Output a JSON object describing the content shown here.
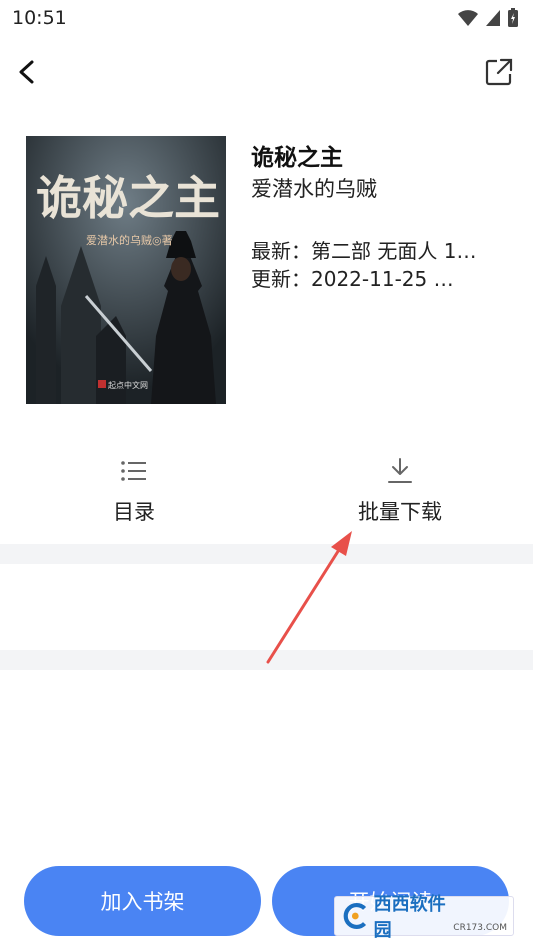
{
  "status_bar": {
    "time": "10:51"
  },
  "book": {
    "title": "诡秘之主",
    "author": "爱潜水的乌贼",
    "latest": "最新：第二部 无面人 1…",
    "updated": "更新：2022-11-25 …",
    "cover": {
      "title_art": "诡秘之主",
      "author_line": "爱潜水的乌贼◎著",
      "publisher": "起点中文网"
    }
  },
  "actions": [
    {
      "label": "目录",
      "icon": "list-icon"
    },
    {
      "label": "批量下载",
      "icon": "download-icon"
    }
  ],
  "bottom": {
    "add_shelf": "加入书架",
    "start_reading": "开始阅读"
  },
  "watermark": {
    "text": "西西软件园",
    "sub": "CR173.COM"
  },
  "colors": {
    "accent": "#4a84f3",
    "annotation_arrow": "#e8504a"
  }
}
